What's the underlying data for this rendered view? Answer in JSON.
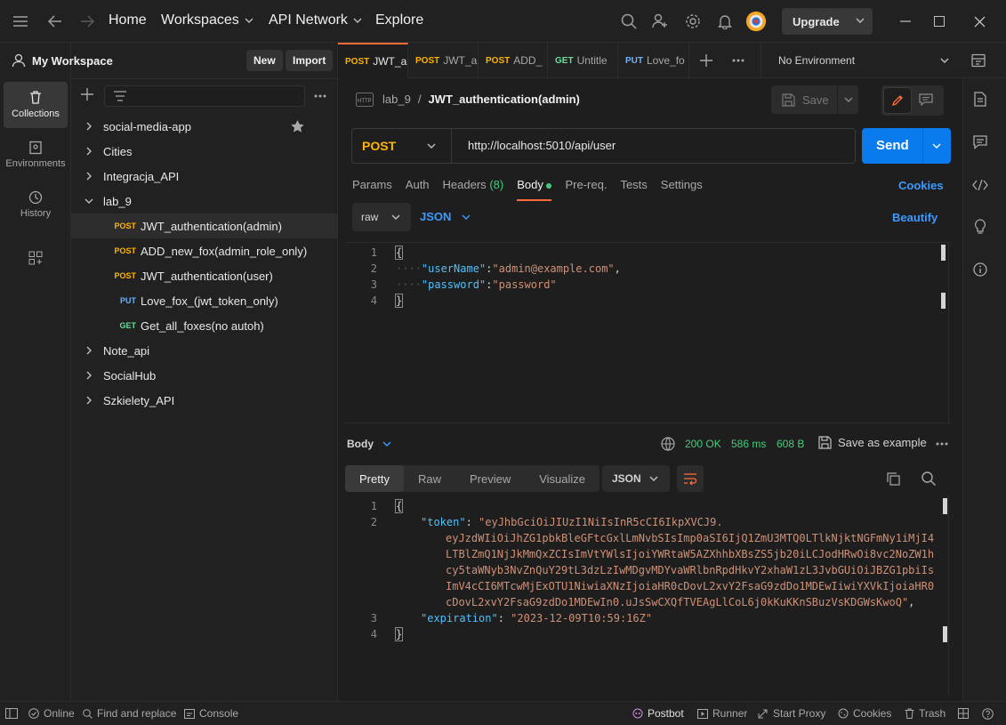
{
  "topbar": {
    "nav": [
      "Home",
      "Workspaces",
      "API Network",
      "Explore"
    ],
    "upgrade_label": "Upgrade"
  },
  "rail": {
    "items": [
      "Collections",
      "Environments",
      "History"
    ]
  },
  "sidebar": {
    "workspace_title": "My Workspace",
    "new_label": "New",
    "import_label": "Import",
    "tree": [
      {
        "label": "social-media-app",
        "starred": true
      },
      {
        "label": "Cities"
      },
      {
        "label": "Integracja_API"
      },
      {
        "label": "lab_9",
        "expanded": true
      },
      {
        "method": "POST",
        "label": "JWT_authentication(admin)",
        "selected": true
      },
      {
        "method": "POST",
        "label": "ADD_new_fox(admin_role_only)"
      },
      {
        "method": "POST",
        "label": "JWT_authentication(user)"
      },
      {
        "method": "PUT",
        "label": "Love_fox_(jwt_token_only)"
      },
      {
        "method": "GET",
        "label": "Get_all_foxes(no autoh)"
      },
      {
        "label": "Note_api"
      },
      {
        "label": "SocialHub"
      },
      {
        "label": "Szkielety_API"
      }
    ]
  },
  "tabs": [
    {
      "method": "POST",
      "label": "JWT_a"
    },
    {
      "method": "POST",
      "label": "JWT_a"
    },
    {
      "method": "POST",
      "label": "ADD_"
    },
    {
      "method": "GET",
      "label": "Untitle"
    },
    {
      "method": "PUT",
      "label": "Love_fo"
    }
  ],
  "environment": "No Environment",
  "request": {
    "breadcrumb_parent": "lab_9",
    "breadcrumb_sep": "/",
    "breadcrumb_name": "JWT_authentication(admin)",
    "save_label": "Save",
    "method": "POST",
    "url": "http://localhost:5010/api/user",
    "send_label": "Send",
    "tabs": [
      "Params",
      "Auth",
      "Headers",
      "(8)",
      "Body",
      "Pre-req.",
      "Tests",
      "Settings"
    ],
    "cookies_label": "Cookies",
    "body_mode": "raw",
    "body_format": "JSON",
    "beautify_label": "Beautify",
    "body_lines": [
      {
        "n": "1",
        "text": "{"
      },
      {
        "n": "2",
        "key": "\"userName\"",
        "val": "\"admin@example.com\"",
        "tail": ","
      },
      {
        "n": "3",
        "key": "\"password\"",
        "val": "\"password\"",
        "tail": ""
      },
      {
        "n": "4",
        "text": "}"
      }
    ]
  },
  "response": {
    "body_label": "Body",
    "status": "200 OK",
    "time": "586 ms",
    "size": "608 B",
    "save_example_label": "Save as example",
    "view_tabs": [
      "Pretty",
      "Raw",
      "Preview",
      "Visualize"
    ],
    "format": "JSON",
    "lines": [
      {
        "n": "1",
        "text": "{"
      },
      {
        "n": "2",
        "key": "\"token\"",
        "val_lines": [
          "\"eyJhbGciOiJIUzI1NiIsInR5cCI6IkpXVCJ9.",
          "eyJzdWIiOiJhZG1pbkBleGFtcGxlLmNvbSIsImp0aSI6IjQ1ZmU3MTQ0LTlkNjktNGFmNy1iMjI4",
          "LTBlZmQ1NjJkMmQxZCIsImVtYWlsIjoiYWRtaW5AZXhhbXBsZS5jb20iLCJodHRwOi8vc2NoZW1h",
          "cy5taWNyb3NvZnQuY29tL3dzLzIwMDgvMDYvaWRlbnRpdHkvY2xhaW1zL3JvbGUiOiJBZG1pbiIs",
          "ImV4cCI6MTcwMjExOTU1NiwiaXNzIjoiaHR0cDovL2xvY2FsaG9zdDo1MDEwIiwiYXVkIjoiaHR0",
          "cDovL2xvY2FsaG9zdDo1MDEwIn0.uJsSwCXQfTVEAgLlCoL6j0kKuKKnSBuzVsKDGWsKwoQ\""
        ],
        "tail": ","
      },
      {
        "n": "3",
        "key": "\"expiration\"",
        "val": "\"2023-12-09T10:59:16Z\""
      },
      {
        "n": "4",
        "text": "}"
      }
    ]
  },
  "statusbar": {
    "online": "Online",
    "find_replace": "Find and replace",
    "console": "Console",
    "postbot": "Postbot",
    "runner": "Runner",
    "start_proxy": "Start Proxy",
    "cookies": "Cookies",
    "trash": "Trash"
  },
  "colors": {
    "accent": "#ff6c37",
    "send": "#097bed",
    "post": "#ffb400",
    "get": "#6bdd9a",
    "put": "#74aef6",
    "status_ok": "#49c97e"
  }
}
